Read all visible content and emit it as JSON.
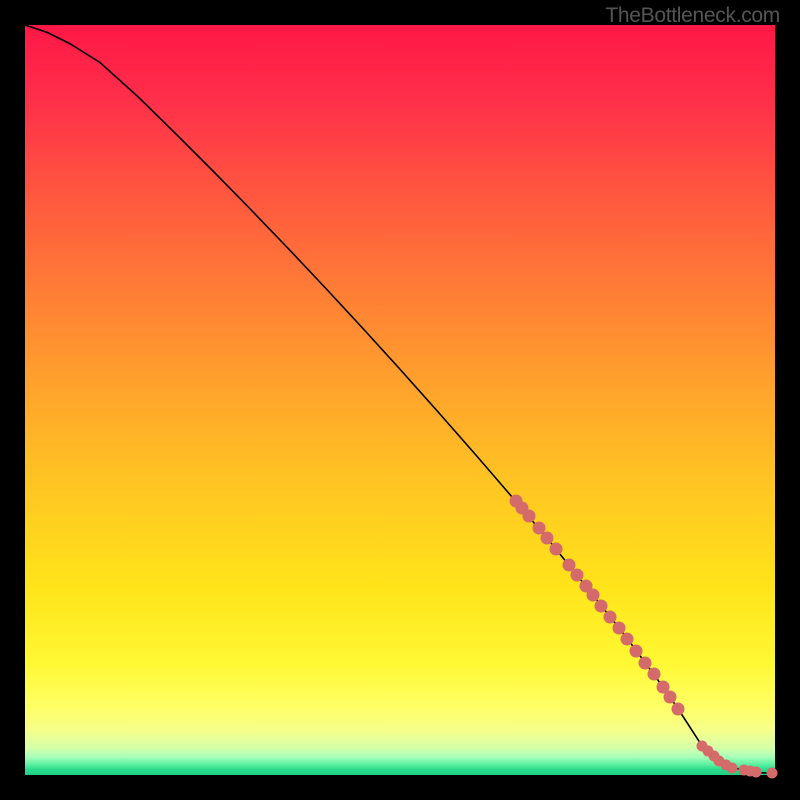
{
  "watermark": "TheBottleneck.com",
  "chart_data": {
    "type": "line",
    "title": "",
    "xlabel": "",
    "ylabel": "",
    "x_range": [
      0,
      100
    ],
    "y_range": [
      0,
      100
    ],
    "curve": {
      "x": [
        0,
        3,
        6,
        10,
        15,
        20,
        25,
        30,
        35,
        40,
        45,
        50,
        55,
        60,
        65,
        70,
        75,
        80,
        82,
        84,
        86,
        88,
        90,
        92,
        94,
        96,
        98,
        100
      ],
      "y": [
        100,
        99,
        97.5,
        95,
        90.5,
        85.6,
        80.6,
        75.5,
        70.3,
        65,
        59.6,
        54.1,
        48.5,
        42.8,
        37,
        31.1,
        24.9,
        18.6,
        15.9,
        13.2,
        10.4,
        7.4,
        4.3,
        2.2,
        1.1,
        0.6,
        0.3,
        0.2
      ]
    },
    "markers_cluster_diagonal": {
      "x_range": [
        65,
        87
      ],
      "sample_points": [
        {
          "x": 65.5,
          "y": 36.5
        },
        {
          "x": 66.3,
          "y": 35.6
        },
        {
          "x": 67.2,
          "y": 34.5
        },
        {
          "x": 68.5,
          "y": 33.0
        },
        {
          "x": 69.6,
          "y": 31.6
        },
        {
          "x": 70.8,
          "y": 30.1
        },
        {
          "x": 72.5,
          "y": 28.0
        },
        {
          "x": 73.6,
          "y": 26.7
        },
        {
          "x": 74.8,
          "y": 25.2
        },
        {
          "x": 75.7,
          "y": 24.0
        },
        {
          "x": 76.8,
          "y": 22.6
        },
        {
          "x": 78.0,
          "y": 21.1
        },
        {
          "x": 79.2,
          "y": 19.6
        },
        {
          "x": 80.3,
          "y": 18.2
        },
        {
          "x": 81.5,
          "y": 16.6
        },
        {
          "x": 82.7,
          "y": 15.0
        },
        {
          "x": 83.8,
          "y": 13.5
        },
        {
          "x": 85.0,
          "y": 11.8
        },
        {
          "x": 86.0,
          "y": 10.4
        },
        {
          "x": 87.1,
          "y": 8.8
        }
      ]
    },
    "markers_cluster_bottom": {
      "y_approx": 0.4,
      "sample_points": [
        {
          "x": 90.3,
          "y": 3.9
        },
        {
          "x": 91.0,
          "y": 3.2
        },
        {
          "x": 91.8,
          "y": 2.5
        },
        {
          "x": 92.5,
          "y": 1.9
        },
        {
          "x": 93.5,
          "y": 1.3
        },
        {
          "x": 94.3,
          "y": 1.0
        },
        {
          "x": 95.8,
          "y": 0.65
        },
        {
          "x": 96.7,
          "y": 0.5
        },
        {
          "x": 97.5,
          "y": 0.4
        },
        {
          "x": 99.6,
          "y": 0.22
        }
      ]
    }
  }
}
